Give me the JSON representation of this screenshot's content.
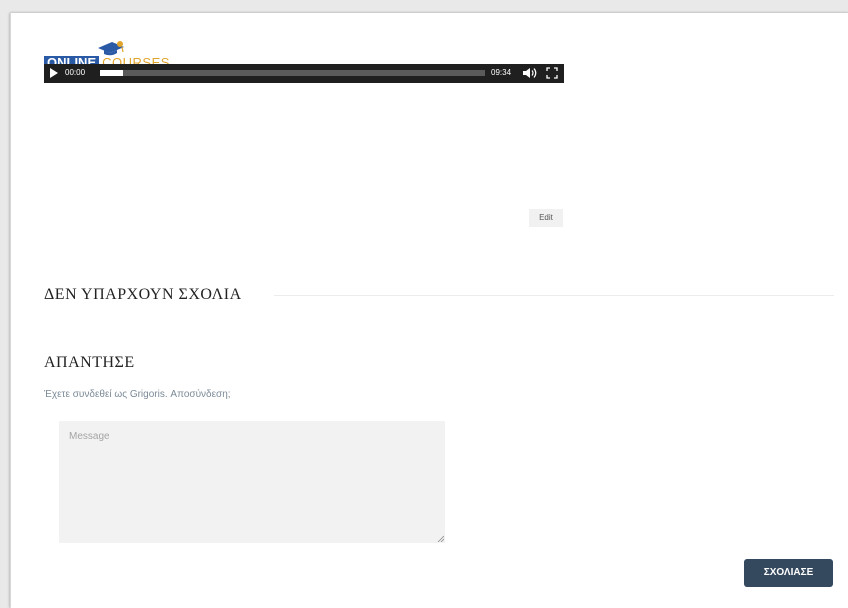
{
  "video": {
    "logo_word_1": "ONLINE",
    "logo_word_2": "COURSES",
    "current_time": "00:00",
    "duration": "09:34",
    "buffered_fraction": 0.06,
    "icons": {
      "play": "play-icon",
      "volume": "volume-icon",
      "fullscreen": "fullscreen-icon"
    }
  },
  "edit_label": "Edit",
  "comments": {
    "no_comments_heading": "ΔΕΝ ΥΠΑΡΧΟΥΝ ΣΧΟΛΙΑ"
  },
  "reply": {
    "title": "ΑΠΑΝΤΗΣΕ",
    "logged_in_prefix": "Έχετε συνδεθεί ως ",
    "user_name": "Grigoris",
    "separator": ". ",
    "logout_link": "Αποσύνδεση;",
    "message_placeholder": "Message",
    "submit_label": "ΣΧΟΛΙΑΣΕ"
  },
  "colors": {
    "button_bg": "#34495e",
    "logo_blue": "#2a5aa6",
    "logo_gold": "#e1a42b",
    "muted_text": "#7b8a97"
  }
}
